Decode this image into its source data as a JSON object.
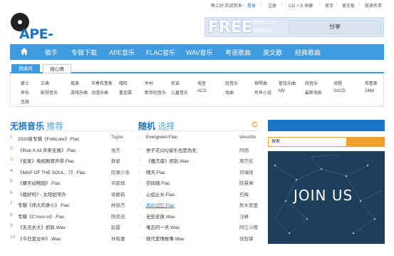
{
  "topbar": {
    "welcome": "晚上好,欢迎到来~",
    "login": "登录",
    "register": "注册",
    "bookmark": "Ctrl + D 收藏",
    "home": "首页",
    "guestbook": "留言板",
    "ban_list": "版谢名单"
  },
  "logo": {
    "text": "APE-FLAC"
  },
  "promo": {
    "free": "FREE",
    "url": "ape-flac.com",
    "sub": "分享给朋友",
    "share": "分享"
  },
  "nav": {
    "items": [
      "歌手",
      "专辑下载",
      "APE音乐",
      "FLAC音乐",
      "WAV音乐",
      "粤语歌曲",
      "英文歌",
      "经典歌曲"
    ]
  },
  "tabs": {
    "active": "按曲风",
    "inactive": "按心情"
  },
  "tags": [
    [
      "爵士",
      "古典",
      "摇滚",
      "节奏布鲁斯",
      "嘻哈",
      "乡村",
      "民谣",
      "电音",
      "轻音乐",
      "钢琴曲",
      "管弦乐曲",
      "纯音乐",
      "说唱",
      "布鲁斯"
    ],
    [
      "声乐",
      "影视音乐",
      "游戏乐曲",
      "动漫乐曲",
      "重金属",
      "新世纪音乐",
      "儿童音乐",
      "ACG",
      "戏曲",
      "有声小说",
      "MV",
      "最新电影",
      "SACD",
      "24bit"
    ],
    [
      "佳赫"
    ]
  ],
  "lossless": {
    "title_a": "无损音乐",
    "title_b": "推荐",
    "items": [
      {
        "n": "1",
        "t": "2020新专辑《FolkLore》.Flac",
        "s": "Taylor"
      },
      {
        "n": "2",
        "t": "《Risk It All 声来无畏》.Flac",
        "s": "张杰"
      },
      {
        "n": "3",
        "t": "《安家》电视剧原声带.Flac",
        "s": "群星"
      },
      {
        "n": "4",
        "t": "《MAP OF THE SOUL : 7》.Flac",
        "s": "防弹少年"
      },
      {
        "n": "5",
        "t": "《摩天动物园》.Flac",
        "s": "邓紫棋"
      },
      {
        "n": "6",
        "t": "《我好吗? - 太阳如常升",
        "s": "梁静茹"
      },
      {
        "n": "7",
        "t": "专辑《伟大的渺小》.Flac",
        "s": "林俊杰"
      },
      {
        "n": "8",
        "t": "专辑《C'mon in》.Flac",
        "s": "陈奕迅"
      },
      {
        "n": "9",
        "t": "《无法长大》抓轨.Wav",
        "s": "赵雷"
      },
      {
        "n": "10",
        "t": "《今日营业中》.Wav",
        "s": "林宥嘉"
      }
    ]
  },
  "random": {
    "title_a": "随机",
    "title_b": "选择",
    "items": [
      {
        "t": "Evergreen.Flac",
        "s": "Westlife"
      },
      {
        "t": "舍子花(QQ音乐也是伪无",
        "s": "阿悄"
      },
      {
        "t": "《魔杰座》抓轨.Wav",
        "s": "周杰伦"
      },
      {
        "t": "晴天.Flac",
        "s": "刘瑞琦"
      },
      {
        "t": "空间感.Flac",
        "s": "陈慧琳"
      },
      {
        "t": "心如止水.Flac",
        "s": "石梅"
      },
      {
        "t": "风の记忆.Flac",
        "s": "熊木杏里"
      },
      {
        "t": "无处安放.Wav",
        "s": "汪峰"
      },
      {
        "t": "难忘的一天.Wav",
        "s": "阿江小僧"
      },
      {
        "t": "现代爱情故事.Wav",
        "s": "张智霖"
      }
    ]
  },
  "sidebar": {
    "search_placeholder": "搜索",
    "banner": "JOIN US"
  },
  "colors": {
    "accent": "#3e9be0",
    "brand": "#1a74c7",
    "orange": "#f0a030"
  }
}
